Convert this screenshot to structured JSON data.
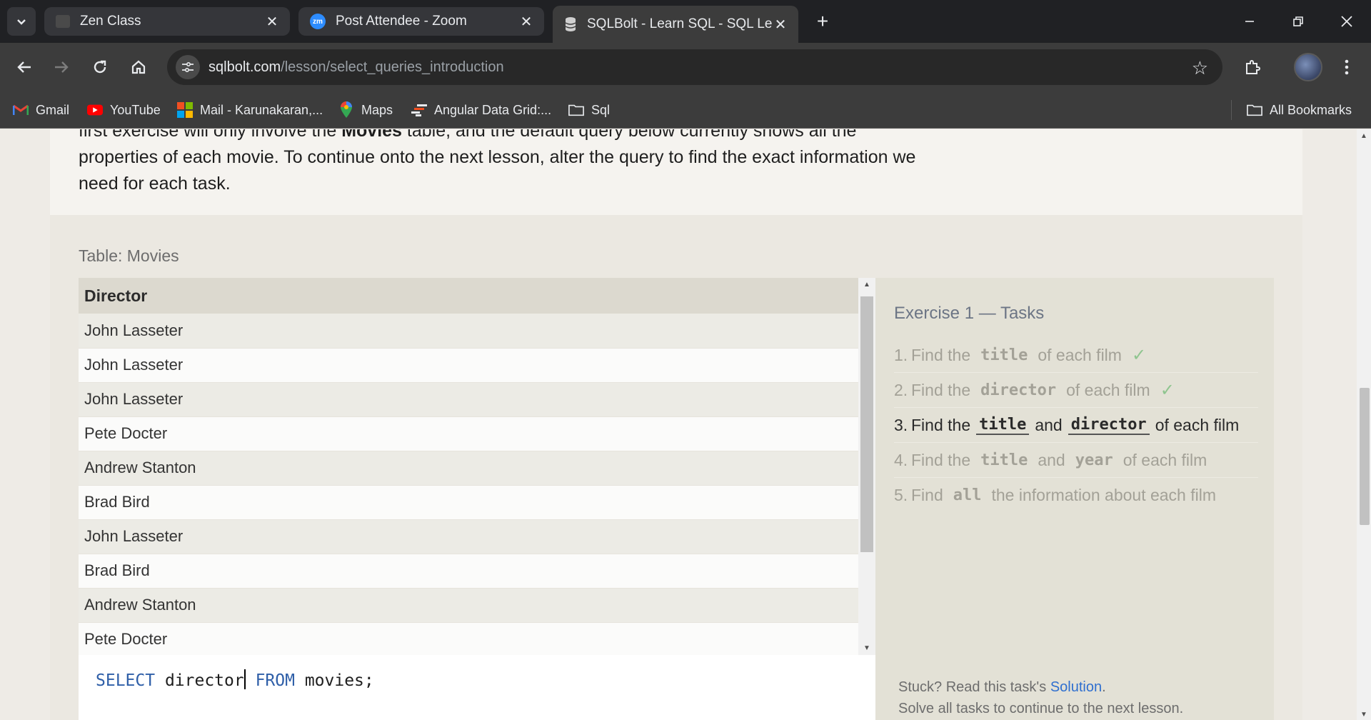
{
  "browser": {
    "tabs": [
      {
        "title": "Zen Class",
        "favicon": "page-icon"
      },
      {
        "title": "Post Attendee - Zoom",
        "favicon": "zoom-icon",
        "favicon_text": "zm"
      },
      {
        "title": "SQLBolt - Learn SQL - SQL Lesso",
        "favicon": "database-icon"
      }
    ],
    "url_host": "sqlbolt.com",
    "url_path": "/lesson/select_queries_introduction",
    "bookmarks": [
      {
        "label": "Gmail",
        "icon": "gmail-icon"
      },
      {
        "label": "YouTube",
        "icon": "youtube-icon"
      },
      {
        "label": "Mail - Karunakaran,...",
        "icon": "microsoft-icon"
      },
      {
        "label": "Maps",
        "icon": "maps-icon"
      },
      {
        "label": "Angular Data Grid:...",
        "icon": "ag-grid-icon"
      },
      {
        "label": "Sql",
        "icon": "folder-icon"
      }
    ],
    "all_bookmarks": "All Bookmarks"
  },
  "lesson": {
    "intro_line1_pre": "first exercise will only involve the ",
    "intro_bold": "Movies",
    "intro_line1_post": " table, and the default query below currently shows all the",
    "intro_line2": "properties of each movie. To continue onto the next lesson, alter the query to find the exact information we",
    "intro_line3": "need for each task."
  },
  "table": {
    "caption": "Table: Movies",
    "column": "Director",
    "rows": [
      "John Lasseter",
      "John Lasseter",
      "John Lasseter",
      "Pete Docter",
      "Andrew Stanton",
      "Brad Bird",
      "John Lasseter",
      "Brad Bird",
      "Andrew Stanton",
      "Pete Docter"
    ]
  },
  "editor": {
    "kw_select": "SELECT",
    "column": " director",
    "kw_from": " FROM",
    "rest": " movies;"
  },
  "tasks": {
    "title": "Exercise 1 — Tasks",
    "items": [
      {
        "num": "1.",
        "pre": "Find the",
        "code1": "title",
        "mid": "",
        "code2": "",
        "post": "of each film",
        "done": true
      },
      {
        "num": "2.",
        "pre": "Find the",
        "code1": "director",
        "mid": "",
        "code2": "",
        "post": "of each film",
        "done": true
      },
      {
        "num": "3.",
        "pre": "Find the",
        "code1": "title",
        "mid": "and",
        "code2": "director",
        "post": "of each film",
        "done": false
      },
      {
        "num": "4.",
        "pre": "Find the",
        "code1": "title",
        "mid": "and",
        "code2": "year",
        "post": "of each film",
        "done": false
      },
      {
        "num": "5.",
        "pre": "Find",
        "code1": "all",
        "mid": "",
        "code2": "",
        "post": "the information about each film",
        "done": false
      }
    ],
    "check": "✓",
    "stuck_text": "Stuck? Read this task's ",
    "solution_link": "Solution",
    "solve_all": "Solve all tasks to continue to the next lesson."
  }
}
